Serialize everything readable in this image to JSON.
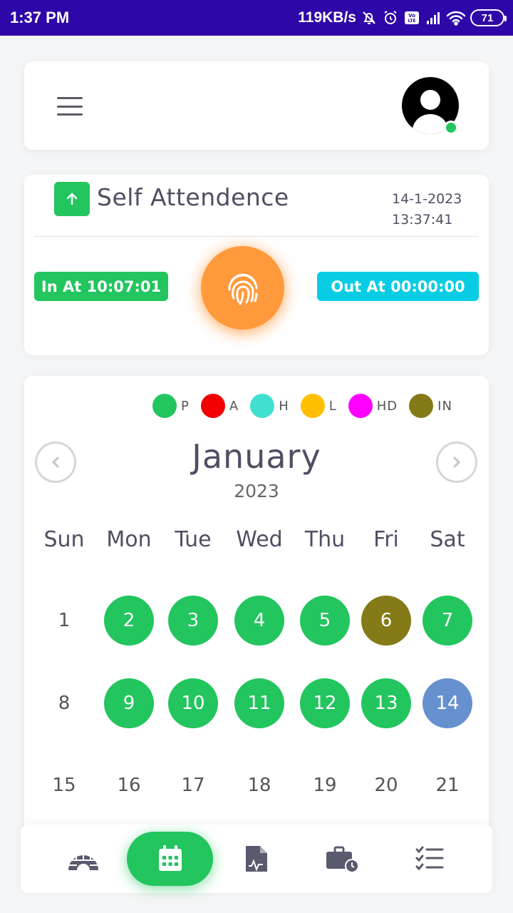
{
  "status_bar": {
    "time": "1:37 PM",
    "net_speed": "119KB/s",
    "battery": "71",
    "icons": [
      "mute-bell-icon",
      "alarm-icon",
      "volte-icon",
      "signal-icon",
      "wifi-icon",
      "battery-icon"
    ]
  },
  "header": {
    "menu_icon": "hamburger-icon",
    "avatar_icon": "user-avatar-icon",
    "online_color": "#22c55e"
  },
  "attendance": {
    "title": "Self Attendence",
    "date": "14-1-2023",
    "time": "13:37:41",
    "in_label": "In At 10:07:01",
    "out_label": "Out At 00:00:00",
    "icon": "arrow-up-icon",
    "button_icon": "fingerprint-icon"
  },
  "legend": [
    {
      "label": "P",
      "color": "#22c55e"
    },
    {
      "label": "A",
      "color": "#f20000"
    },
    {
      "label": "H",
      "color": "#40e0d0"
    },
    {
      "label": "L",
      "color": "#ffbf00"
    },
    {
      "label": "HD",
      "color": "#ff00ff"
    },
    {
      "label": "IN",
      "color": "#847a18"
    }
  ],
  "calendar": {
    "month": "January",
    "year": "2023",
    "weekdays": [
      "Sun",
      "Mon",
      "Tue",
      "Wed",
      "Thu",
      "Fri",
      "Sat"
    ],
    "weeks": [
      [
        {
          "d": "1",
          "s": ""
        },
        {
          "d": "2",
          "s": "P"
        },
        {
          "d": "3",
          "s": "P"
        },
        {
          "d": "4",
          "s": "P"
        },
        {
          "d": "5",
          "s": "P"
        },
        {
          "d": "6",
          "s": "IN"
        },
        {
          "d": "7",
          "s": "P"
        }
      ],
      [
        {
          "d": "8",
          "s": ""
        },
        {
          "d": "9",
          "s": "P"
        },
        {
          "d": "10",
          "s": "P"
        },
        {
          "d": "11",
          "s": "P"
        },
        {
          "d": "12",
          "s": "P"
        },
        {
          "d": "13",
          "s": "P"
        },
        {
          "d": "14",
          "s": "TODAY"
        }
      ],
      [
        {
          "d": "15",
          "s": ""
        },
        {
          "d": "16",
          "s": ""
        },
        {
          "d": "17",
          "s": ""
        },
        {
          "d": "18",
          "s": ""
        },
        {
          "d": "19",
          "s": ""
        },
        {
          "d": "20",
          "s": ""
        },
        {
          "d": "21",
          "s": ""
        }
      ]
    ],
    "status_colors": {
      "P": "#22c55e",
      "IN": "#847a18",
      "TODAY": "#6790cf"
    }
  },
  "bottom_nav": {
    "items": [
      "igloo-icon",
      "calendar-icon",
      "document-chart-icon",
      "briefcase-clock-icon",
      "task-list-icon"
    ],
    "active": "calendar-icon"
  }
}
